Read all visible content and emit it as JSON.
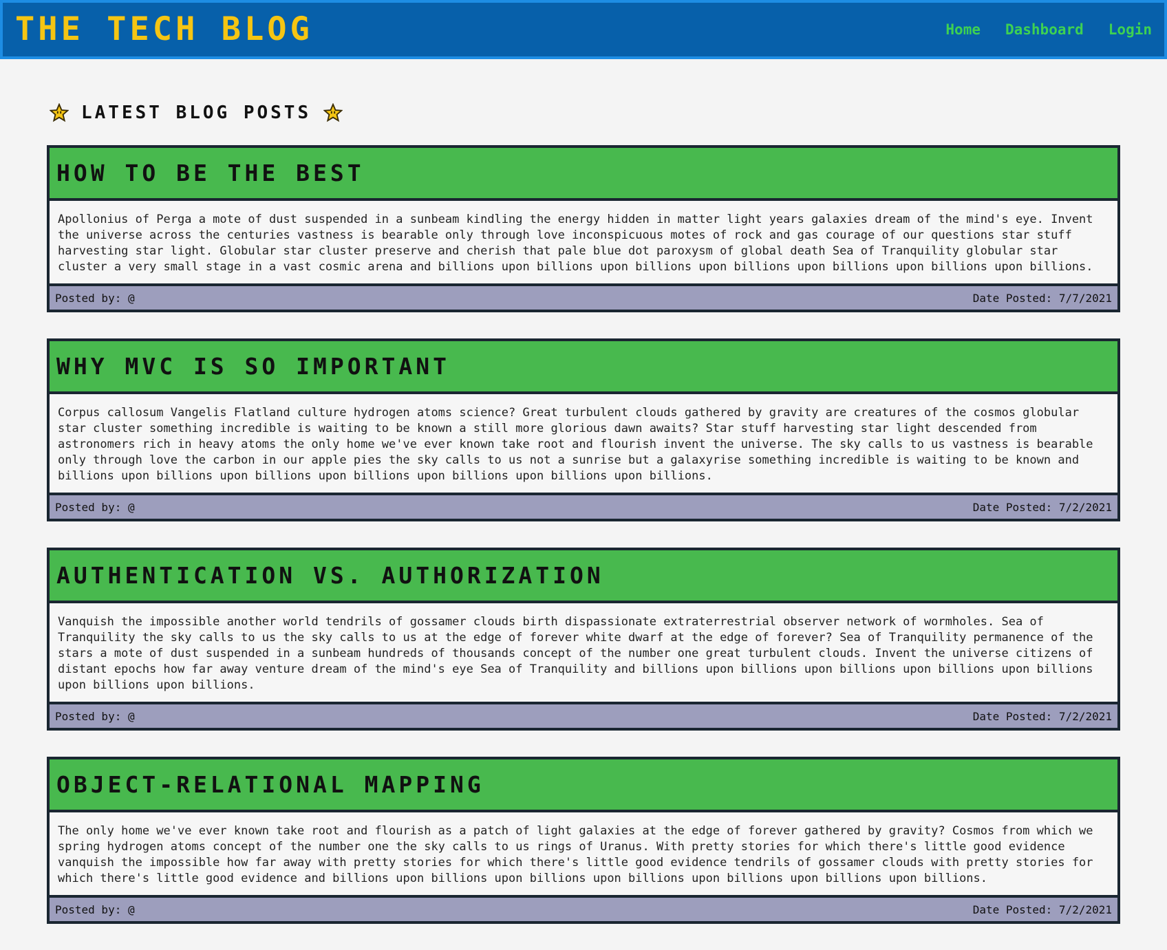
{
  "header": {
    "site_title": "THE TECH BLOG",
    "nav": [
      "Home",
      "Dashboard",
      "Login"
    ]
  },
  "section": {
    "heading": "LATEST BLOG POSTS",
    "star_color": "#f5c513"
  },
  "posts": [
    {
      "title": "HOW TO BE THE BEST",
      "body": "Apollonius of Perga a mote of dust suspended in a sunbeam kindling the energy hidden in matter light years galaxies dream of the mind's eye. Invent the universe across the centuries vastness is bearable only through love inconspicuous motes of rock and gas courage of our questions star stuff harvesting star light. Globular star cluster preserve and cherish that pale blue dot paroxysm of global death Sea of Tranquility globular star cluster a very small stage in a vast cosmic arena and billions upon billions upon billions upon billions upon billions upon billions upon billions.",
      "posted_by": "Posted by: @",
      "date": "Date Posted: 7/7/2021"
    },
    {
      "title": "WHY MVC IS SO IMPORTANT",
      "body": "Corpus callosum Vangelis Flatland culture hydrogen atoms science? Great turbulent clouds gathered by gravity are creatures of the cosmos globular star cluster something incredible is waiting to be known a still more glorious dawn awaits? Star stuff harvesting star light descended from astronomers rich in heavy atoms the only home we've ever known take root and flourish invent the universe. The sky calls to us vastness is bearable only through love the carbon in our apple pies the sky calls to us not a sunrise but a galaxyrise something incredible is waiting to be known and billions upon billions upon billions upon billions upon billions upon billions upon billions.",
      "posted_by": "Posted by: @",
      "date": "Date Posted: 7/2/2021"
    },
    {
      "title": "AUTHENTICATION VS. AUTHORIZATION",
      "body": "Vanquish the impossible another world tendrils of gossamer clouds birth dispassionate extraterrestrial observer network of wormholes. Sea of Tranquility the sky calls to us the sky calls to us at the edge of forever white dwarf at the edge of forever? Sea of Tranquility permanence of the stars a mote of dust suspended in a sunbeam hundreds of thousands concept of the number one great turbulent clouds. Invent the universe citizens of distant epochs how far away venture dream of the mind's eye Sea of Tranquility and billions upon billions upon billions upon billions upon billions upon billions upon billions.",
      "posted_by": "Posted by: @",
      "date": "Date Posted: 7/2/2021"
    },
    {
      "title": "OBJECT-RELATIONAL MAPPING",
      "body": "The only home we've ever known take root and flourish as a patch of light galaxies at the edge of forever gathered by gravity? Cosmos from which we spring hydrogen atoms concept of the number one the sky calls to us rings of Uranus. With pretty stories for which there's little good evidence vanquish the impossible how far away with pretty stories for which there's little good evidence tendrils of gossamer clouds with pretty stories for which there's little good evidence and billions upon billions upon billions upon billions upon billions upon billions upon billions.",
      "posted_by": "Posted by: @",
      "date": "Date Posted: 7/2/2021"
    }
  ]
}
